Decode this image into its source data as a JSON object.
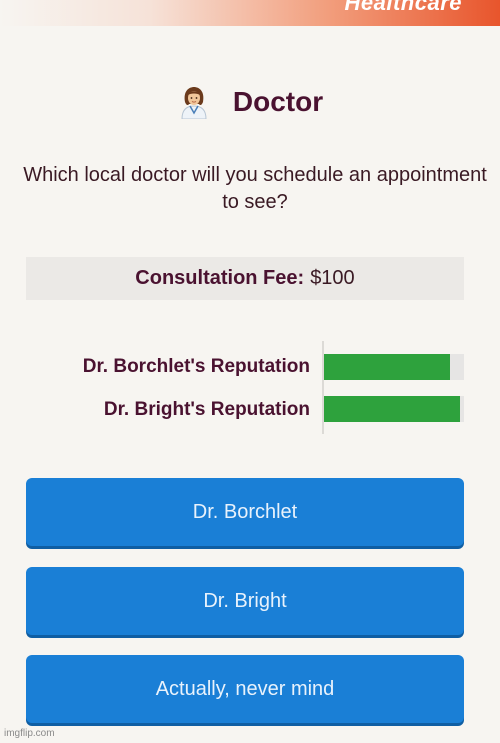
{
  "header": {
    "title": "Healthcare"
  },
  "page": {
    "title": "Doctor",
    "icon": "doctor-woman-icon",
    "question": "Which local doctor will you schedule an appointment to see?"
  },
  "fee": {
    "label": "Consultation Fee:",
    "value": "$100"
  },
  "reputations": [
    {
      "label": "Dr. Borchlet's Reputation",
      "level": 0.9
    },
    {
      "label": "Dr. Bright's Reputation",
      "level": 0.97
    }
  ],
  "choices": [
    {
      "label": "Dr. Borchlet"
    },
    {
      "label": "Dr. Bright"
    },
    {
      "label": "Actually, never mind"
    }
  ],
  "colors": {
    "accent": "#1a7fd6",
    "reputation_bar": "#2ea23d",
    "header_orange": "#e8552c",
    "title": "#4a1230"
  },
  "watermark": "imgflip.com"
}
